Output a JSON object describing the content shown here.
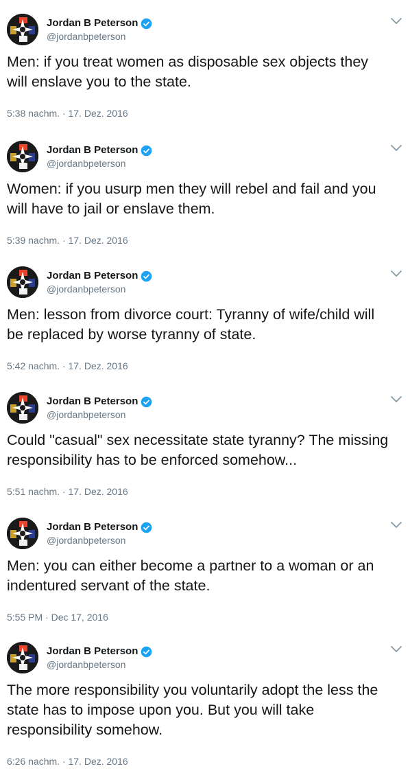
{
  "author": {
    "name": "Jordan B Peterson",
    "handle": "@jordanbpeterson",
    "verified": true,
    "avatar_icon": "compass-rose-logo-icon",
    "accent_color": "#1da1f2"
  },
  "tweets": [
    {
      "text": "Men: if you treat women as disposable sex objects they\nwill enslave you to the state.",
      "timestamp": "5:38 nachm. · 17. Dez. 2016"
    },
    {
      "text": "Women: if you usurp men they will rebel and fail and you\nwill have to jail or enslave them.",
      "timestamp": "5:39 nachm. · 17. Dez. 2016"
    },
    {
      "text": "Men: lesson from divorce court: Tyranny of wife/child will\nbe replaced by worse tyranny of state.",
      "timestamp": "5:42 nachm. · 17. Dez. 2016"
    },
    {
      "text": "Could \"casual\" sex necessitate state tyranny? The missing\nresponsibility has to be enforced somehow...",
      "timestamp": "5:51 nachm. · 17. Dez. 2016"
    },
    {
      "text": "Men: you can either become a partner to a woman or an\nindentured servant of the state.",
      "timestamp": "5:55 PM · Dec 17, 2016"
    },
    {
      "text": "The more responsibility you voluntarily adopt the less the\nstate has to impose upon you. But you will take\nresponsibility somehow.",
      "timestamp": "6:26 nachm. · 17. Dez. 2016"
    }
  ]
}
